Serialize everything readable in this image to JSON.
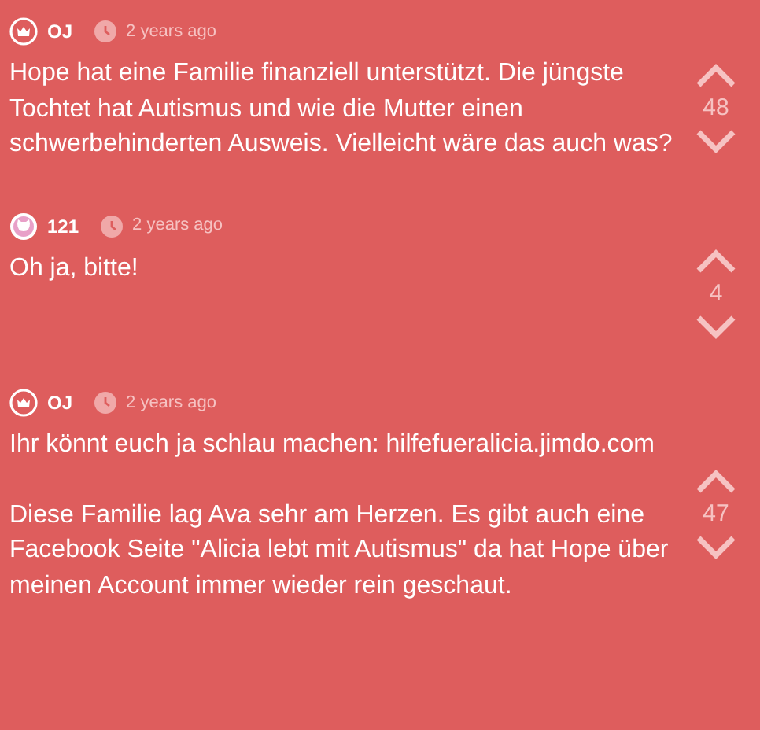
{
  "comments": [
    {
      "kind": "crown",
      "author": "OJ",
      "time": "2 years ago",
      "paragraphs": [
        "Hope hat eine Familie finanziell unterstützt. Die jüngste Tochtet hat Autismus und wie die Mutter einen schwerbehinderten Ausweis. Vielleicht wäre das auch was?"
      ],
      "votes": "48"
    },
    {
      "kind": "cat",
      "author": "121",
      "time": "2 years ago",
      "paragraphs": [
        "Oh ja, bitte!"
      ],
      "votes": "4"
    },
    {
      "kind": "crown",
      "author": "OJ",
      "time": "2 years ago",
      "paragraphs": [
        "Ihr könnt euch ja schlau machen: hilfefueralicia.jimdo.com",
        "Diese Familie lag Ava sehr am Herzen. Es gibt auch eine Facebook Seite \"Alicia lebt mit Autismus\" da hat Hope über meinen Account immer wieder rein geschaut."
      ],
      "votes": "47"
    }
  ]
}
